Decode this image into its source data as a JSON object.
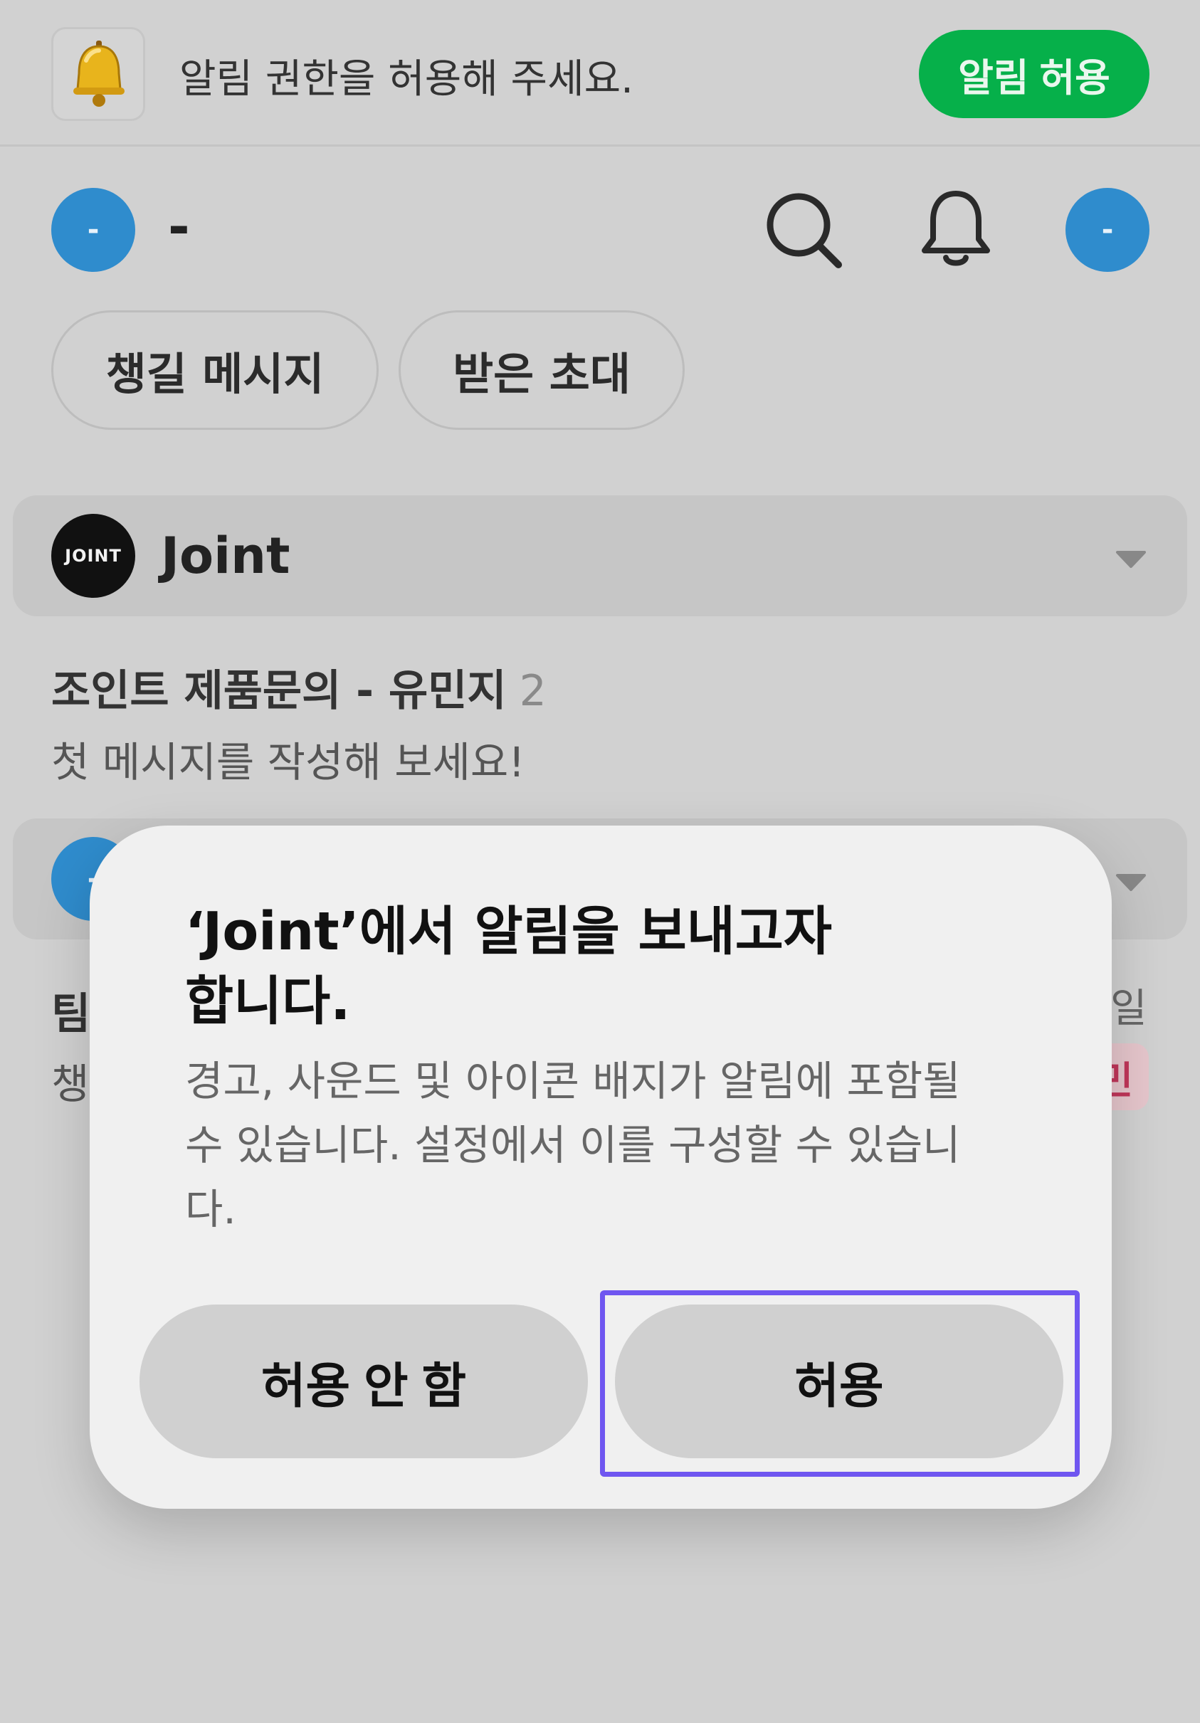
{
  "banner": {
    "icon": "bell-icon",
    "text": "알림 권한을 허용해 주세요.",
    "button_label": "알림 허용",
    "button_color": "#06b04a"
  },
  "header": {
    "avatar_left_label": "-",
    "name": "-",
    "search_icon": "search-icon",
    "notification_icon": "bell-outline-icon",
    "avatar_right_label": "-",
    "avatar_color": "#2f8ccd"
  },
  "chips": [
    {
      "label": "챙길 메시지"
    },
    {
      "label": "받은 초대"
    }
  ],
  "groups": [
    {
      "logo_text": "JOINT",
      "title": "Joint",
      "rooms": [
        {
          "title": "조인트 제품문의 - 유민지",
          "count": "2",
          "preview": "첫 메시지를 작성해 보세요!"
        }
      ]
    },
    {
      "avatar_label": "-",
      "rooms": [
        {
          "title": "팀",
          "preview": "챙",
          "date": "일",
          "badge": "민"
        }
      ]
    }
  ],
  "dialog": {
    "title": "‘Joint’에서 알림을 보내고자 합니다.",
    "message": "경고, 사운드 및 아이콘 배지가 알림에 포함될 수 있습니다. 설정에서 이를 구성할 수 있습니다.",
    "deny_label": "허용 안 함",
    "allow_label": "허용",
    "highlight_color": "#6f56f0"
  }
}
